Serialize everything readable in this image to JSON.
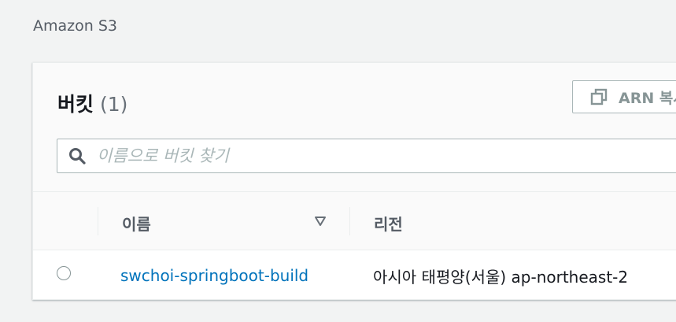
{
  "breadcrumb": {
    "service": "Amazon S3"
  },
  "panel": {
    "title": "버킷",
    "count": "(1)",
    "arn_button_label": "ARN 복사",
    "search": {
      "placeholder": "이름으로 버킷 찾기",
      "value": ""
    }
  },
  "table": {
    "columns": [
      {
        "label": "이름"
      },
      {
        "label": "리전"
      }
    ],
    "rows": [
      {
        "name": "swchoi-springboot-build",
        "region": "아시아 태평양(서울) ap-northeast-2",
        "selected": false
      }
    ]
  },
  "colors": {
    "link": "#0073bb",
    "background": "#f2f3f3",
    "panel": "#ffffff",
    "header_bg": "#fafafa",
    "muted_text": "#545b64",
    "placeholder": "#aab7b8"
  },
  "icons": {
    "copy": "copy-icon",
    "search": "search-icon",
    "sort": "sort-descending-icon",
    "radio": "radio-unselected"
  }
}
